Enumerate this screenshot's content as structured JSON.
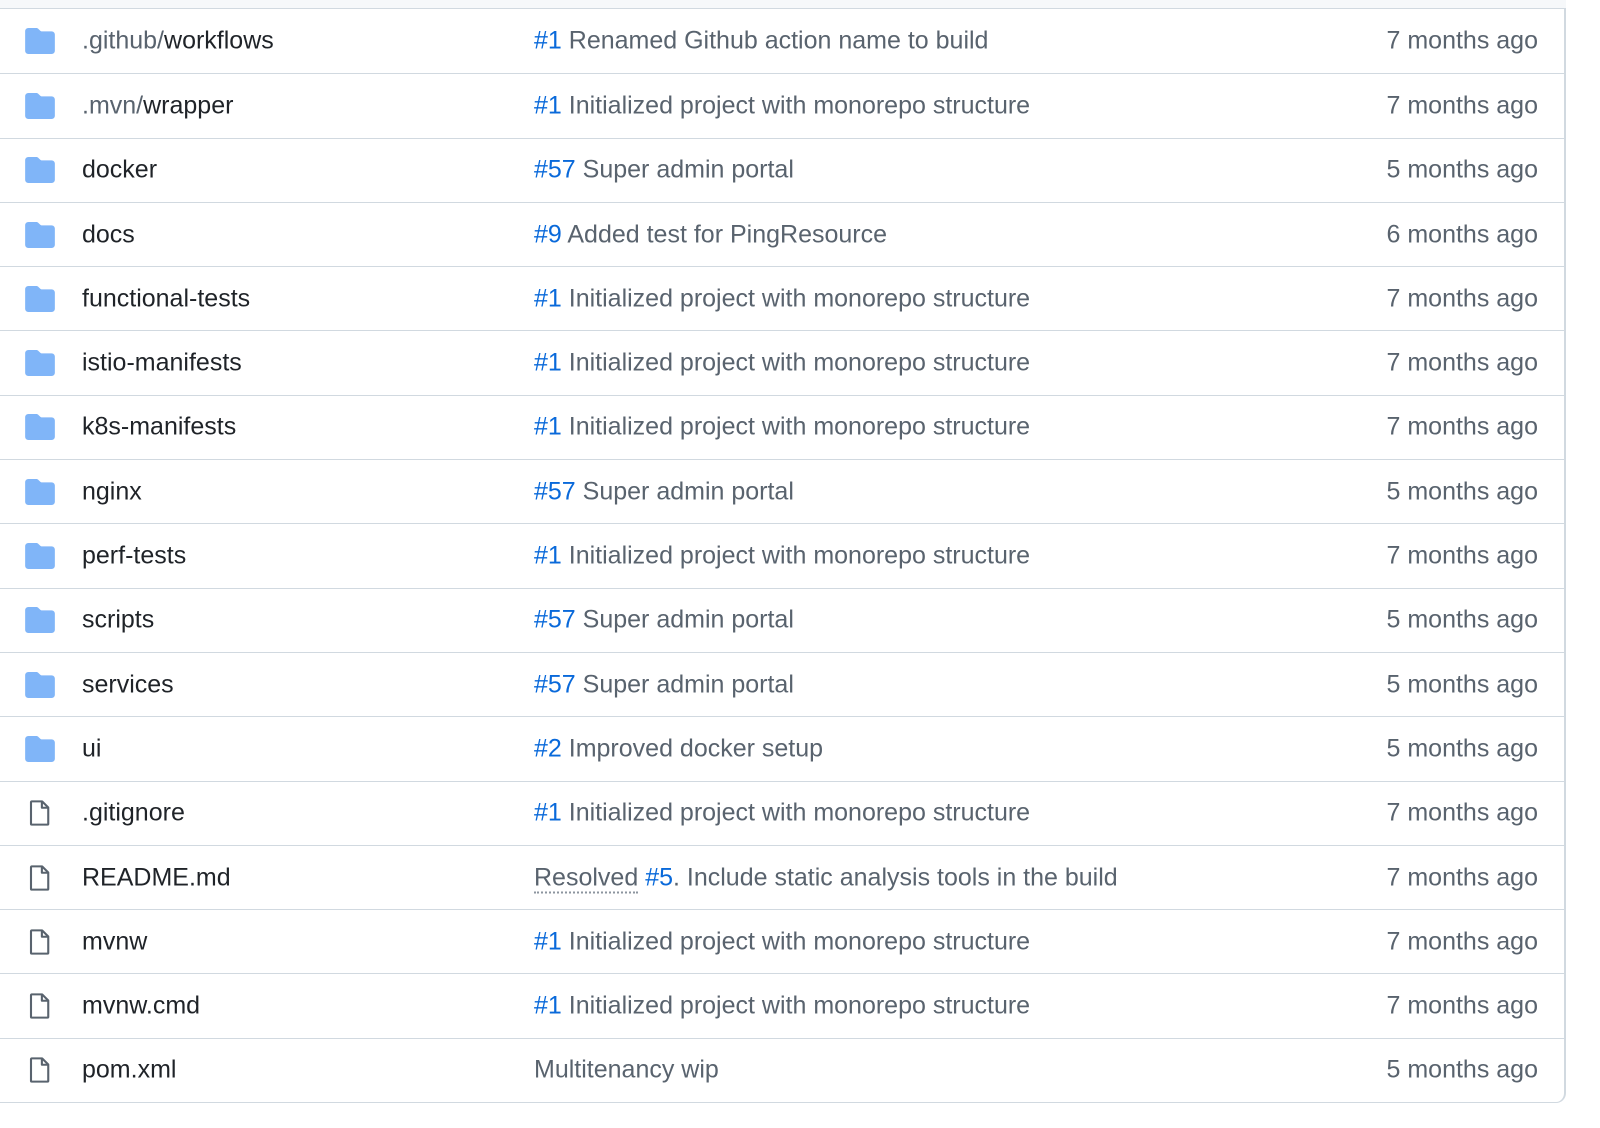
{
  "colors": {
    "folder": "#80b5f8",
    "file_icon": "#59636e",
    "link": "#0969da",
    "muted_text": "#59636e",
    "primary_text": "#1f2328",
    "border": "#d1d9e0"
  },
  "rows": [
    {
      "type": "folder",
      "icon": "folder-icon",
      "name_prefix": ".github/",
      "name": "workflows",
      "msg_pre": "",
      "msg_link": "#1",
      "msg_text": " Renamed Github action name to build",
      "date": "7 months ago"
    },
    {
      "type": "folder",
      "icon": "folder-icon",
      "name_prefix": ".mvn/",
      "name": "wrapper",
      "msg_pre": "",
      "msg_link": "#1",
      "msg_text": " Initialized project with monorepo structure",
      "date": "7 months ago"
    },
    {
      "type": "folder",
      "icon": "folder-icon",
      "name_prefix": "",
      "name": "docker",
      "msg_pre": "",
      "msg_link": "#57",
      "msg_text": " Super admin portal",
      "date": "5 months ago"
    },
    {
      "type": "folder",
      "icon": "folder-icon",
      "name_prefix": "",
      "name": "docs",
      "msg_pre": "",
      "msg_link": "#9",
      "msg_text": " Added test for PingResource",
      "date": "6 months ago"
    },
    {
      "type": "folder",
      "icon": "folder-icon",
      "name_prefix": "",
      "name": "functional-tests",
      "msg_pre": "",
      "msg_link": "#1",
      "msg_text": " Initialized project with monorepo structure",
      "date": "7 months ago"
    },
    {
      "type": "folder",
      "icon": "folder-icon",
      "name_prefix": "",
      "name": "istio-manifests",
      "msg_pre": "",
      "msg_link": "#1",
      "msg_text": " Initialized project with monorepo structure",
      "date": "7 months ago"
    },
    {
      "type": "folder",
      "icon": "folder-icon",
      "name_prefix": "",
      "name": "k8s-manifests",
      "msg_pre": "",
      "msg_link": "#1",
      "msg_text": " Initialized project with monorepo structure",
      "date": "7 months ago"
    },
    {
      "type": "folder",
      "icon": "folder-icon",
      "name_prefix": "",
      "name": "nginx",
      "msg_pre": "",
      "msg_link": "#57",
      "msg_text": " Super admin portal",
      "date": "5 months ago"
    },
    {
      "type": "folder",
      "icon": "folder-icon",
      "name_prefix": "",
      "name": "perf-tests",
      "msg_pre": "",
      "msg_link": "#1",
      "msg_text": " Initialized project with monorepo structure",
      "date": "7 months ago"
    },
    {
      "type": "folder",
      "icon": "folder-icon",
      "name_prefix": "",
      "name": "scripts",
      "msg_pre": "",
      "msg_link": "#57",
      "msg_text": " Super admin portal",
      "date": "5 months ago"
    },
    {
      "type": "folder",
      "icon": "folder-icon",
      "name_prefix": "",
      "name": "services",
      "msg_pre": "",
      "msg_link": "#57",
      "msg_text": " Super admin portal",
      "date": "5 months ago"
    },
    {
      "type": "folder",
      "icon": "folder-icon",
      "name_prefix": "",
      "name": "ui",
      "msg_pre": "",
      "msg_link": "#2",
      "msg_text": " Improved docker setup",
      "date": "5 months ago"
    },
    {
      "type": "file",
      "icon": "file-icon",
      "name_prefix": "",
      "name": ".gitignore",
      "msg_pre": "",
      "msg_link": "#1",
      "msg_text": " Initialized project with monorepo structure",
      "date": "7 months ago"
    },
    {
      "type": "file",
      "icon": "file-icon",
      "name_prefix": "",
      "name": "README.md",
      "msg_pre": "Resolved",
      "msg_link": "#5",
      "msg_text": ". Include static analysis tools in the build",
      "date": "7 months ago"
    },
    {
      "type": "file",
      "icon": "file-icon",
      "name_prefix": "",
      "name": "mvnw",
      "msg_pre": "",
      "msg_link": "#1",
      "msg_text": " Initialized project with monorepo structure",
      "date": "7 months ago"
    },
    {
      "type": "file",
      "icon": "file-icon",
      "name_prefix": "",
      "name": "mvnw.cmd",
      "msg_pre": "",
      "msg_link": "#1",
      "msg_text": " Initialized project with monorepo structure",
      "date": "7 months ago"
    },
    {
      "type": "file",
      "icon": "file-icon",
      "name_prefix": "",
      "name": "pom.xml",
      "msg_pre": "",
      "msg_link": "",
      "msg_text": "Multitenancy wip",
      "date": "5 months ago"
    }
  ]
}
